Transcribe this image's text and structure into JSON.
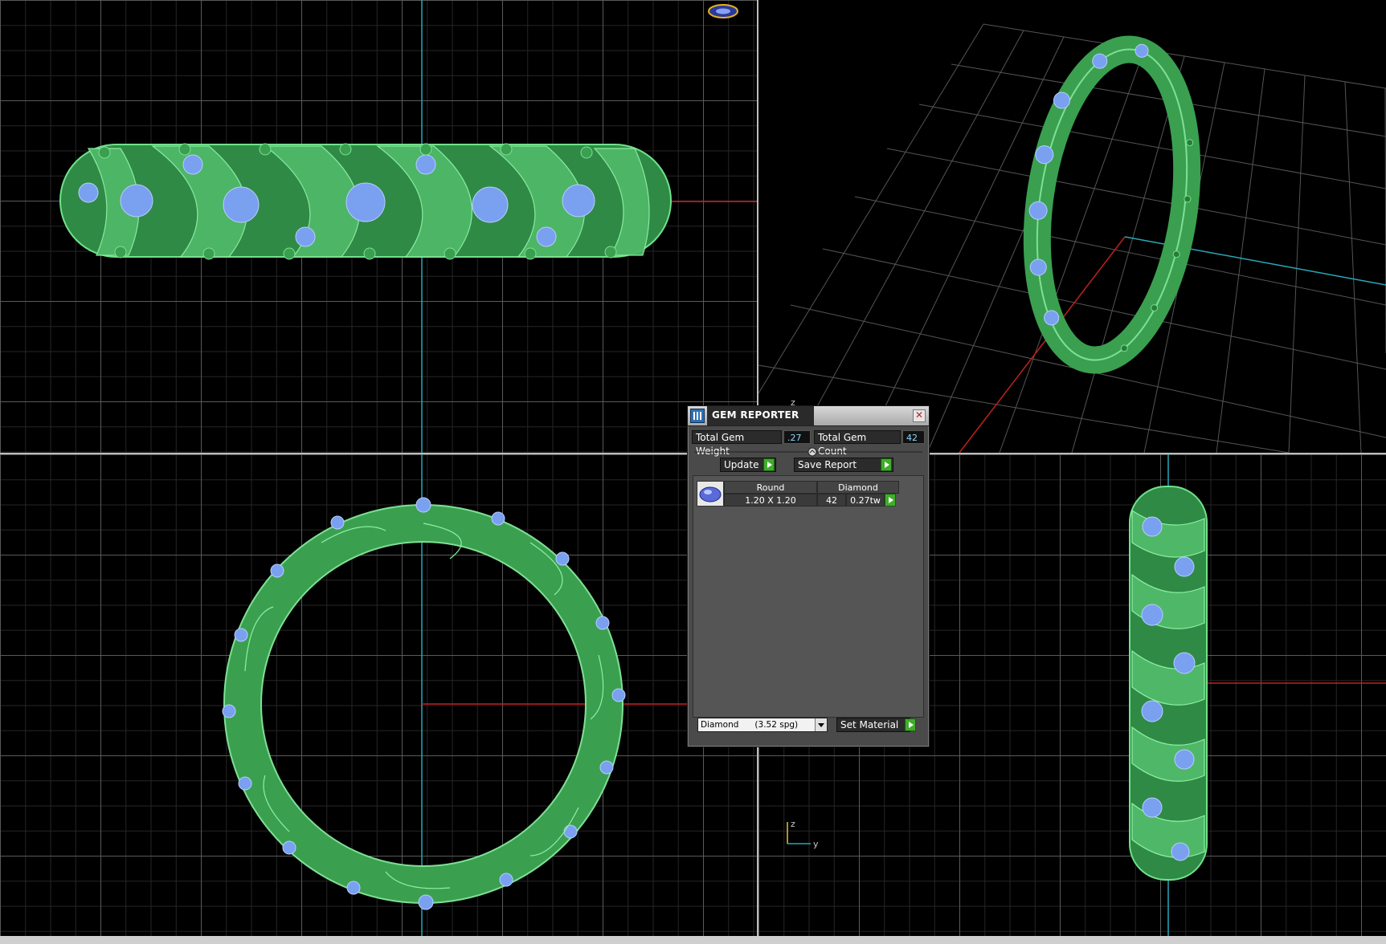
{
  "gem_reporter": {
    "title": "GEM REPORTER",
    "close_glyph": "✕",
    "total_gem_weight_label": "Total Gem Weight",
    "total_gem_weight_value": ".27",
    "total_gem_count_label": "Total Gem Count",
    "total_gem_count_value": "42",
    "update_label": "Update",
    "save_report_label": "Save Report",
    "gem_row": {
      "shape": "Round",
      "material": "Diamond",
      "size": "1.20 X 1.20",
      "count": "42",
      "weight": "0.27tw"
    },
    "material_select_value": "Diamond      (3.52 spg)",
    "set_material_label": "Set Material"
  },
  "viewports": {
    "side_axis_z": "z",
    "side_axis_y": "y",
    "persp_axis_z": "z"
  },
  "colors": {
    "ring_green": "#4fb868",
    "gem_blue": "#7aa0f0",
    "axis_red": "#c02020",
    "axis_cyan": "#28a8b8",
    "accent_green_button": "#3fae2a"
  }
}
